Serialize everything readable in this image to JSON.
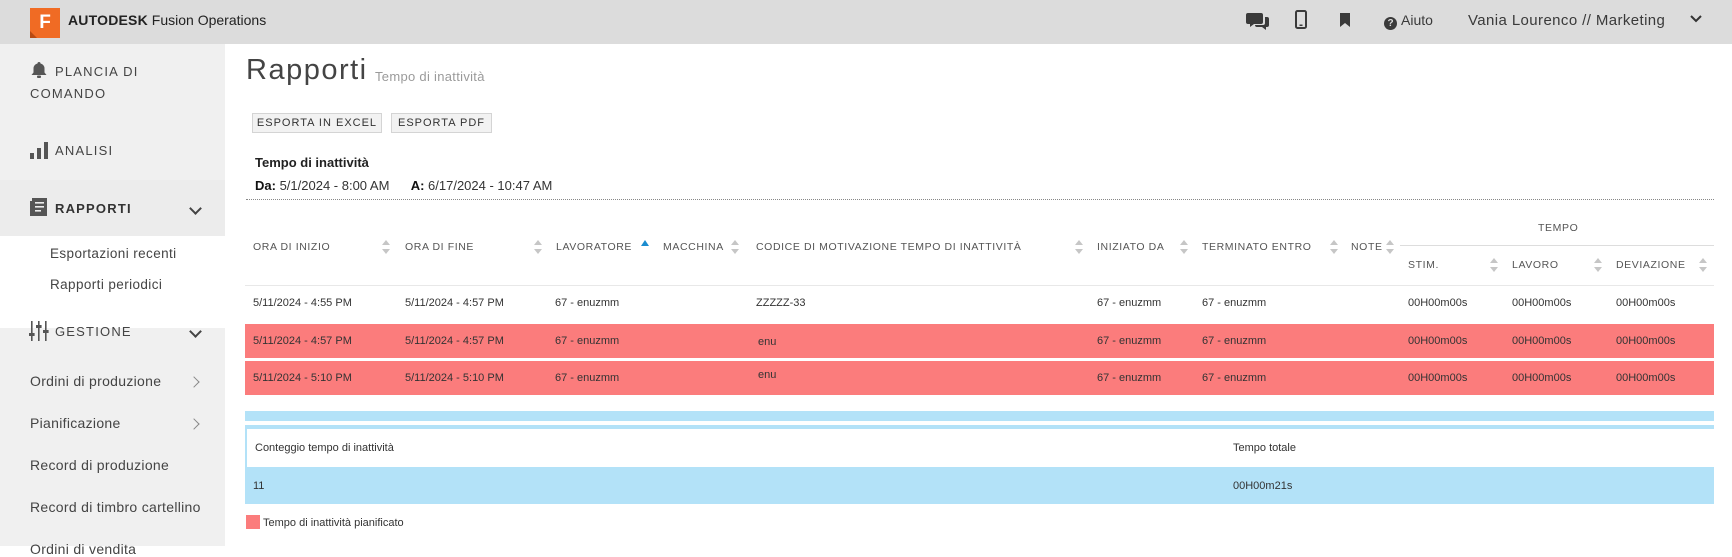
{
  "topbar": {
    "logo_letter": "F",
    "brand_bold": "AUTODESK",
    "brand_rest": "Fusion Operations",
    "help_label": "Aiuto",
    "user_label": "Vania Lourenco // Marketing",
    "icons": [
      "chat-icon",
      "mobile-icon",
      "bookmark-icon",
      "help-icon",
      "chevron-down-icon"
    ]
  },
  "sidebar": {
    "dashboard_line1": "PLANCIA DI",
    "dashboard_line2": "COMANDO",
    "analysis": "ANALISI",
    "reports": "RAPPORTI",
    "reports_sub": [
      "Esportazioni recenti",
      "Rapporti periodici"
    ],
    "management": "GESTIONE",
    "links": [
      "Ordini di produzione",
      "Pianificazione",
      "Record di produzione",
      "Record di timbro cartellino",
      "Ordini di vendita"
    ]
  },
  "page": {
    "title": "Rapporti",
    "subtitle": "Tempo di inattività",
    "export_excel": "ESPORTA IN EXCEL",
    "export_pdf": "ESPORTA PDF",
    "report_title": "Tempo di inattività",
    "from_label": "Da:",
    "from_value": "5/1/2024 - 8:00 AM",
    "to_label": "A:",
    "to_value": "6/17/2024 - 10:47 AM"
  },
  "table": {
    "headers": {
      "start": "ORA DI INIZIO",
      "end": "ORA DI FINE",
      "worker": "LAVORATORE",
      "machine": "MACCHINA",
      "reason": "CODICE DI MOTIVAZIONE TEMPO DI INATTIVITÀ",
      "started_by": "INIZIATO DA",
      "ended_by": "TERMINATO ENTRO",
      "note": "NOTE",
      "tempo": "TEMPO",
      "stim": "STIM.",
      "lavoro": "LAVORO",
      "deviazione": "DEVIAZIONE"
    },
    "rows": [
      {
        "start": "5/11/2024 - 4:55 PM",
        "end": "5/11/2024 - 4:57 PM",
        "worker": "67 - enuzmm",
        "machine": "",
        "reason": "ZZZZZ-33",
        "started_by": "67 - enuzmm",
        "ended_by": "67 - enuzmm",
        "note": "",
        "stim": "00H00m00s",
        "lavoro": "00H00m00s",
        "deviazione": "00H00m00s",
        "planned": false
      },
      {
        "start": "5/11/2024 - 4:57 PM",
        "end": "5/11/2024 - 4:57 PM",
        "worker": "67 - enuzmm",
        "machine": "",
        "reason": "enu",
        "started_by": "67 - enuzmm",
        "ended_by": "67 - enuzmm",
        "note": "",
        "stim": "00H00m00s",
        "lavoro": "00H00m00s",
        "deviazione": "00H00m00s",
        "planned": true
      },
      {
        "start": "5/11/2024 - 5:10 PM",
        "end": "5/11/2024 - 5:10 PM",
        "worker": "67 - enuzmm",
        "machine": "",
        "reason": "enu",
        "started_by": "67 - enuzmm",
        "ended_by": "67 - enuzmm",
        "note": "",
        "stim": "00H00m00s",
        "lavoro": "00H00m00s",
        "deviazione": "00H00m00s",
        "planned": true
      }
    ]
  },
  "summary": {
    "count_label": "Conteggio tempo di inattività",
    "total_label": "Tempo totale",
    "count_value": "11",
    "total_value": "00H00m21s"
  },
  "legend": {
    "label": "Tempo di inattività pianificato",
    "color": "#fb7c7c"
  },
  "colors": {
    "brand": "#f06b24",
    "planned_row": "#fb7c7c",
    "summary_blue": "#b3e2f8",
    "sort_active": "#1a8ccf"
  }
}
